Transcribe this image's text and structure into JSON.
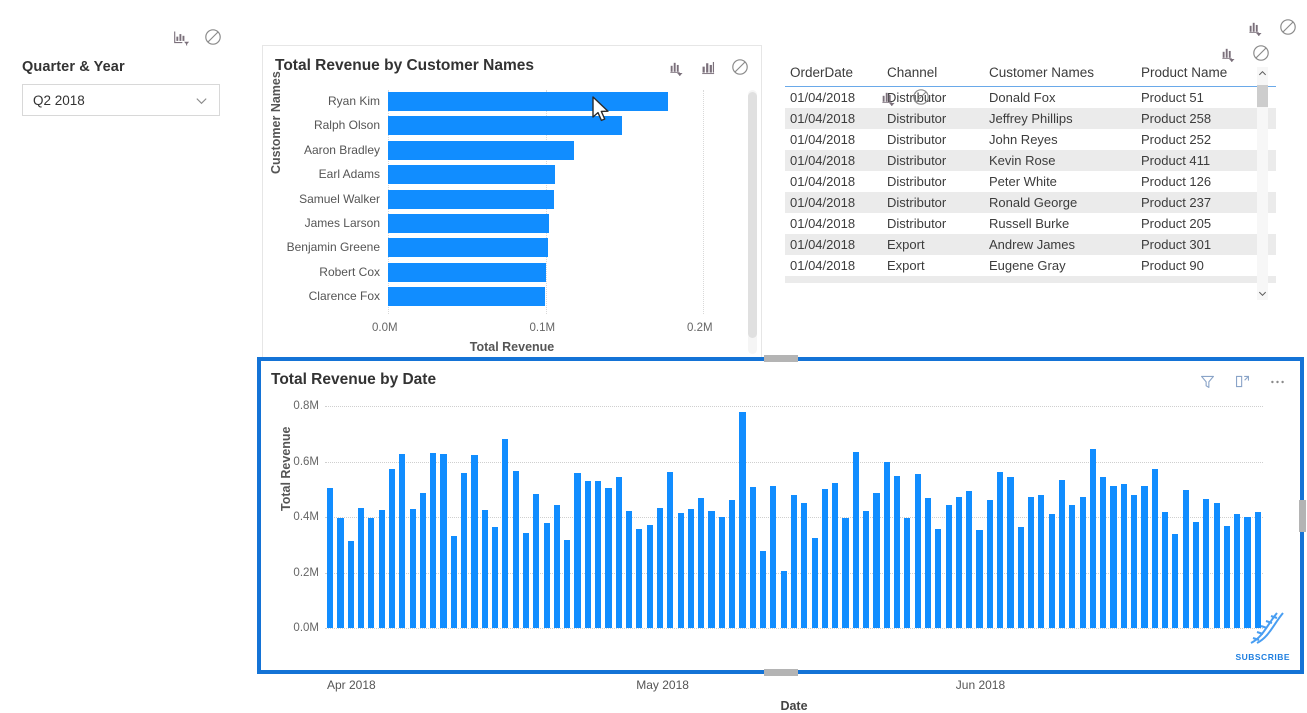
{
  "slicer": {
    "title": "Quarter & Year",
    "selected_value": "Q2 2018",
    "icons": {
      "filter_chart": "filter-chart-icon",
      "no_filter": "no-entry-icon",
      "chevron": "chevron-down-icon"
    }
  },
  "bar_visual": {
    "title": "Total Revenue by Customer Names",
    "icons": {
      "drill": "drill-filter-icon",
      "chart": "bar-chart-icon",
      "block": "no-entry-icon"
    }
  },
  "table_visual": {
    "columns": [
      "OrderDate",
      "Channel",
      "Customer Names",
      "Product Name"
    ],
    "rows": [
      [
        "01/04/2018",
        "Distributor",
        "Donald Fox",
        "Product 51"
      ],
      [
        "01/04/2018",
        "Distributor",
        "Jeffrey Phillips",
        "Product 258"
      ],
      [
        "01/04/2018",
        "Distributor",
        "John Reyes",
        "Product 252"
      ],
      [
        "01/04/2018",
        "Distributor",
        "Kevin Rose",
        "Product 411"
      ],
      [
        "01/04/2018",
        "Distributor",
        "Peter White",
        "Product 126"
      ],
      [
        "01/04/2018",
        "Distributor",
        "Ronald George",
        "Product 237"
      ],
      [
        "01/04/2018",
        "Distributor",
        "Russell Burke",
        "Product 205"
      ],
      [
        "01/04/2018",
        "Export",
        "Andrew James",
        "Product 301"
      ],
      [
        "01/04/2018",
        "Export",
        "Eugene Gray",
        "Product 90"
      ]
    ],
    "icons": {
      "filter_chart": "filter-chart-icon",
      "block": "no-entry-icon",
      "scroll_up": "chevron-up-icon",
      "scroll_down": "chevron-down-icon"
    }
  },
  "date_visual": {
    "title": "Total Revenue by Date",
    "icons": {
      "filter": "funnel-icon",
      "focus": "focus-mode-icon",
      "more": "more-options-icon"
    },
    "watermark": "SUBSCRIBE",
    "selected": true
  },
  "colors": {
    "bar_blue": "#118DFF",
    "selection_border": "#1473d6",
    "header_underline": "#6aa9e9",
    "alt_row": "#ebebeb",
    "text": "#333333"
  },
  "chart_data": [
    {
      "type": "bar",
      "orientation": "horizontal",
      "title": "Total Revenue by Customer Names",
      "xlabel": "Total Revenue",
      "ylabel": "Customer Names",
      "xlim": [
        0,
        200000
      ],
      "xticks": [
        0,
        100000,
        200000
      ],
      "xtick_labels": [
        "0.0M",
        "0.1M",
        "0.2M"
      ],
      "grid": true,
      "categories": [
        "Ryan Kim",
        "Ralph Olson",
        "Aaron Bradley",
        "Earl Adams",
        "Samuel Walker",
        "James Larson",
        "Benjamin Greene",
        "Robert Cox",
        "Clarence Fox"
      ],
      "values": [
        177500,
        148500,
        118000,
        106000,
        105500,
        102000,
        101500,
        100500,
        99500
      ]
    },
    {
      "type": "bar",
      "orientation": "vertical",
      "title": "Total Revenue by Date",
      "xlabel": "Date",
      "ylabel": "Total Revenue",
      "ylim": [
        0,
        800000
      ],
      "yticks": [
        0,
        200000,
        400000,
        600000,
        800000
      ],
      "ytick_labels": [
        "0.0M",
        "0.2M",
        "0.4M",
        "0.6M",
        "0.8M"
      ],
      "xtick_labels": [
        "Apr 2018",
        "May 2018",
        "Jun 2018"
      ],
      "grid": true,
      "categories": [
        "01/04/2018",
        "02/04/2018",
        "03/04/2018",
        "04/04/2018",
        "05/04/2018",
        "06/04/2018",
        "07/04/2018",
        "08/04/2018",
        "09/04/2018",
        "10/04/2018",
        "11/04/2018",
        "12/04/2018",
        "13/04/2018",
        "14/04/2018",
        "15/04/2018",
        "16/04/2018",
        "17/04/2018",
        "18/04/2018",
        "19/04/2018",
        "20/04/2018",
        "21/04/2018",
        "22/04/2018",
        "23/04/2018",
        "24/04/2018",
        "25/04/2018",
        "26/04/2018",
        "27/04/2018",
        "28/04/2018",
        "29/04/2018",
        "30/04/2018",
        "01/05/2018",
        "02/05/2018",
        "03/05/2018",
        "04/05/2018",
        "05/05/2018",
        "06/05/2018",
        "07/05/2018",
        "08/05/2018",
        "09/05/2018",
        "10/05/2018",
        "11/05/2018",
        "12/05/2018",
        "13/05/2018",
        "14/05/2018",
        "15/05/2018",
        "16/05/2018",
        "17/05/2018",
        "18/05/2018",
        "19/05/2018",
        "20/05/2018",
        "21/05/2018",
        "22/05/2018",
        "23/05/2018",
        "24/05/2018",
        "25/05/2018",
        "26/05/2018",
        "27/05/2018",
        "28/05/2018",
        "29/05/2018",
        "30/05/2018",
        "31/05/2018",
        "01/06/2018",
        "02/06/2018",
        "03/06/2018",
        "04/06/2018",
        "05/06/2018",
        "06/06/2018",
        "07/06/2018",
        "08/06/2018",
        "09/06/2018",
        "10/06/2018",
        "11/06/2018",
        "12/06/2018",
        "13/06/2018",
        "14/06/2018",
        "15/06/2018",
        "16/06/2018",
        "17/06/2018",
        "18/06/2018",
        "19/06/2018",
        "20/06/2018",
        "21/06/2018",
        "22/06/2018",
        "23/06/2018",
        "24/06/2018",
        "25/06/2018",
        "26/06/2018",
        "27/06/2018",
        "28/06/2018",
        "29/06/2018",
        "30/06/2018"
      ],
      "values": [
        505000,
        395000,
        312000,
        432000,
        397000,
        425000,
        572000,
        628000,
        430000,
        485000,
        632000,
        628000,
        332000,
        558000,
        622000,
        425000,
        365000,
        680000,
        565000,
        342000,
        482000,
        380000,
        445000,
        318000,
        560000,
        530000,
        528000,
        505000,
        545000,
        420000,
        358000,
        372000,
        432000,
        562000,
        415000,
        430000,
        468000,
        422000,
        400000,
        462000,
        778000,
        508000,
        278000,
        512000,
        205000,
        480000,
        452000,
        325000,
        500000,
        522000,
        397000,
        635000,
        422000,
        485000,
        600000,
        548000,
        398000,
        555000,
        470000,
        358000,
        445000,
        472000,
        495000,
        352000,
        460000,
        562000,
        545000,
        365000,
        472000,
        480000,
        412000,
        532000,
        445000,
        472000,
        645000,
        545000,
        512000,
        518000,
        480000,
        510000,
        572000,
        418000,
        340000,
        498000,
        382000,
        465000,
        452000,
        368000,
        412000,
        400000,
        418000
      ]
    }
  ]
}
